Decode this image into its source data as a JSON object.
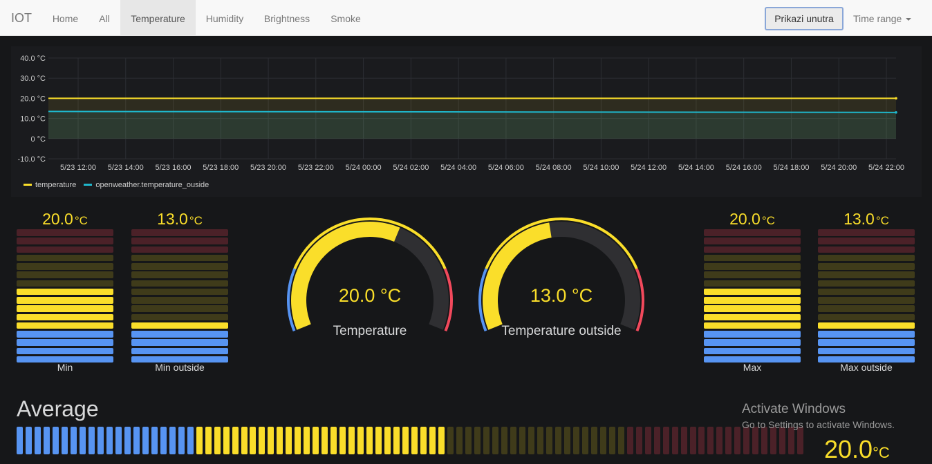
{
  "navbar": {
    "brand": "IOT",
    "tabs": [
      {
        "label": "Home"
      },
      {
        "label": "All"
      },
      {
        "label": "Temperature",
        "active": true
      },
      {
        "label": "Humidity"
      },
      {
        "label": "Brightness"
      },
      {
        "label": "Smoke"
      }
    ],
    "button_label": "Prikazi unutra",
    "time_range_label": "Time range",
    "time_range_icon": "caret-down-icon"
  },
  "graph": {
    "y_ticks": [
      "40.0 °C",
      "30.0 °C",
      "20.0 °C",
      "10.0 °C",
      "0 °C",
      "-10.0 °C"
    ],
    "x_ticks": [
      "5/23 12:00",
      "5/23 14:00",
      "5/23 16:00",
      "5/23 18:00",
      "5/23 20:00",
      "5/23 22:00",
      "5/24 00:00",
      "5/24 02:00",
      "5/24 04:00",
      "5/24 06:00",
      "5/24 08:00",
      "5/24 10:00",
      "5/24 12:00",
      "5/24 14:00",
      "5/24 16:00",
      "5/24 18:00",
      "5/24 20:00",
      "5/24 22:00"
    ],
    "legend": [
      {
        "label": "temperature",
        "color": "#fade2a"
      },
      {
        "label": "openweather.temperature_ouside",
        "color": "#1fb7cc"
      }
    ]
  },
  "chart_data": {
    "type": "line",
    "ylim": [
      -10,
      40
    ],
    "x": [
      "5/23 11:00",
      "5/24 22:50"
    ],
    "series": [
      {
        "name": "temperature",
        "color": "#fade2a",
        "values": [
          20.0,
          20.0
        ]
      },
      {
        "name": "openweather.temperature_ouside",
        "color": "#1fb7cc",
        "values": [
          13.5,
          13.0
        ]
      }
    ]
  },
  "bargauges_left": [
    {
      "value": "20.0",
      "unit": "°C",
      "label": "Min",
      "level": 20.0
    },
    {
      "value": "13.0",
      "unit": "°C",
      "label": "Min outside",
      "level": 13.0
    }
  ],
  "bargauges_right": [
    {
      "value": "20.0",
      "unit": "°C",
      "label": "Max",
      "level": 20.0
    },
    {
      "value": "13.0",
      "unit": "°C",
      "label": "Max outside",
      "level": 13.0
    }
  ],
  "gauges": [
    {
      "value": "20.0 °C",
      "title": "Temperature",
      "level": 20.0
    },
    {
      "value": "13.0 °C",
      "title": "Temperature outside",
      "level": 13.0
    }
  ],
  "average": {
    "title": "Average",
    "value": "20.0",
    "unit": "°C",
    "level": 20.0
  },
  "colors": {
    "blue": "#5794f2",
    "yellow": "#fade2a",
    "red": "#f2495c",
    "olive_dim": "#3f3b1a",
    "red_dim": "#4b2128",
    "accent_button_border": "#8aa7d8"
  },
  "windows_watermark": {
    "title": "Activate Windows",
    "subtitle": "Go to Settings to activate Windows."
  }
}
